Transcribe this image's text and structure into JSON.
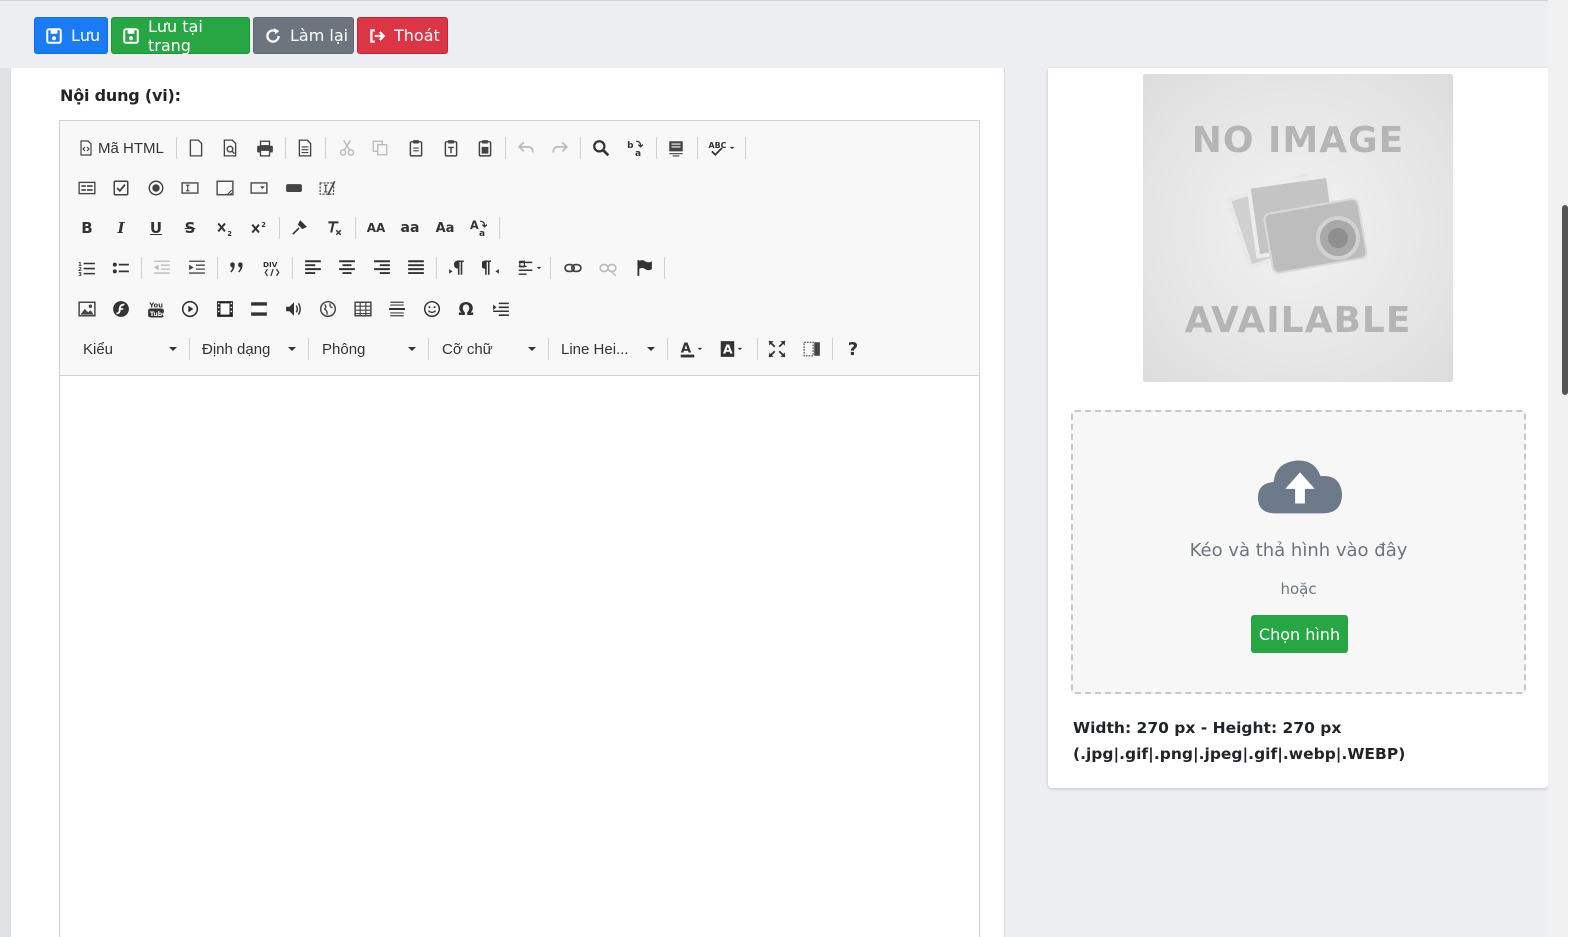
{
  "actions": {
    "save": "Lưu",
    "save_stay": "Lưu tại trang",
    "reset": "Làm lại",
    "exit": "Thoát"
  },
  "editor": {
    "label": "Nội dung (vi):",
    "source_button": "Mã HTML",
    "combos": {
      "style": "Kiểu",
      "format": "Định dạng",
      "font": "Phông",
      "size": "Cỡ chữ",
      "line_height": "Line Hei..."
    },
    "bold": "B",
    "italic": "I",
    "underline": "U",
    "strike": "S",
    "uppercase": "AA",
    "lowercase": "aa",
    "titlecase": "Aa",
    "help": "?"
  },
  "image_panel": {
    "placeholder_top": "NO IMAGE",
    "placeholder_bottom": "AVAILABLE",
    "drop_text": "Kéo và thả hình vào đây",
    "or_text": "hoặc",
    "choose_button": "Chọn hình",
    "size_info": "Width: 270 px - Height: 270 px",
    "formats": "(.jpg|.gif|.png|.jpeg|.gif|.webp|.WEBP)"
  },
  "colors": {
    "blue": "#1a7cf5",
    "green": "#27a744",
    "gray": "#6c757d",
    "red": "#dc3545"
  }
}
